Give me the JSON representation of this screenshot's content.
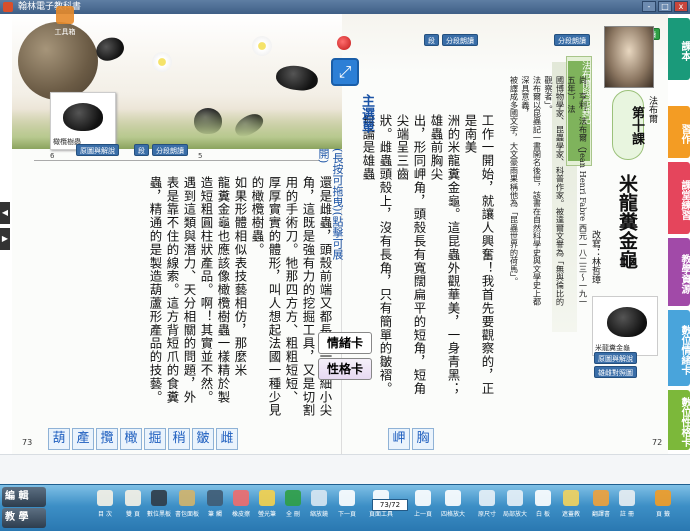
{
  "window": {
    "title": "翰林電子教科書",
    "buttons": [
      "-",
      "□",
      "x"
    ]
  },
  "left_page": {
    "specimen_label": "橄欖樹蟲",
    "tags": {
      "explain": "原圖與解說",
      "para": "段",
      "para_read": "分段朗讀"
    },
    "ruler_marks": [
      "6",
      "5"
    ],
    "columns": [
      "還是雌蟲，頭殼前端又都長出一對細小尖",
      "角，這既是強有力的挖掘工具，又是切割",
      "用的手術刀。牠那四方方、粗粗短短、",
      "厚厚實實的體形，叫人想起法國一種少見",
      "的橄欖樹蟲。",
      "如果形體相似表技藝相仿，那麼米",
      "龍糞金龜也應該像橄欖樹蟲一樣精於製",
      "造短粗圓柱狀產品。啊！其實並不然。",
      "遇到這類與潛力、天分相關的問題，外",
      "表是靠不住的線索。這方背短爪的食糞",
      "蟲，精通的是製造葫蘆形產品的技藝。"
    ],
    "page_number": "73",
    "vocab": [
      "葫",
      "產",
      "攬",
      "橄",
      "掘",
      "稍",
      "皺",
      "雌"
    ]
  },
  "main_menu": {
    "title": "主選單",
    "subtitle": "(長按可拖曳)(點擊可展開)"
  },
  "cards": {
    "emotion": "情緒卡",
    "personality": "性格卡"
  },
  "right_page": {
    "tags": {
      "para": "段",
      "para_read": "分段朗讀",
      "para_read2": "分段朗讀",
      "text_read": "課文朗讀",
      "explain": "原圖與解說",
      "compare": "雄雌對照圖"
    },
    "columns": [
      "工作一開始，就讓人興奮！我首先要觀察的，正是南美",
      "洲的米龍糞金龜。這昆蟲外觀華美，一身青黑；雄蟲前胸尖",
      "出，形同岬角，頭殼長有寬闊扁平的短角，短角尖端呈三齒",
      "狀。雌蟲頭殼上，沒有長角，只有簡單的皺褶。無論是雄蟲"
    ],
    "note_title": "法布爾與昆蟲記",
    "note_columns": [
      "尚．亨利．法布爾（Jean Henri Fabre 西元一八二三～一九一五年），法",
      "國博物學家、昆蟲學家、科普作家。被達爾文譽為「無與倫比的觀察者」。",
      "法布爾以昆蟲記一書開名後世，該書在自然科學史與文學史上都深具意義，",
      "被譯成多國文字，大文豪雨果稱他為「昆蟲世界的荷馬」。"
    ],
    "lesson": "第十課",
    "author_name": "法布爾",
    "title": "米龍糞金龜",
    "adaptation": "改寫：林哲璋",
    "specimen_label": "米龍糞金龜",
    "page_number": "72",
    "vocab": [
      "岬",
      "胸"
    ]
  },
  "side_tabs": [
    {
      "label": "課本",
      "color": "#1a9a7a"
    },
    {
      "label": "習作",
      "color": "#f39c24"
    },
    {
      "label": "課堂練習",
      "color": "#e5455c"
    },
    {
      "label": "教學資源",
      "color": "#a14aa8"
    },
    {
      "label": "數位情緒卡",
      "color": "#49a4db"
    },
    {
      "label": "數位性格卡",
      "color": "#7cb83a"
    }
  ],
  "left_tools": {
    "edit": "編 輯",
    "teach": "教 學",
    "toolbox": "工具箱"
  },
  "toolbar": [
    {
      "label": "目 次",
      "color": "#f6f2e6"
    },
    {
      "label": "雙 頁",
      "color": "#f6f2e6"
    },
    {
      "label": "數位黑板",
      "color": "#2f3b47"
    },
    {
      "label": "書包面板",
      "color": "#d3b46a"
    },
    {
      "label": "筆 觸",
      "color": "#3f5b73"
    },
    {
      "label": "橡皮擦",
      "color": "#ef6b6b"
    },
    {
      "label": "螢光筆",
      "color": "#f6d24b"
    },
    {
      "label": "全 刪",
      "color": "#2f9e45"
    },
    {
      "label": "縮放鏡",
      "color": "#d8e7f2"
    },
    {
      "label": "下一頁",
      "color": "#ffffff"
    },
    {
      "label": "頁面工具",
      "color": "#ffffff"
    },
    {
      "label": "上一頁",
      "color": "#ffffff"
    },
    {
      "label": "四格放大",
      "color": "#ffffff"
    },
    {
      "label": "原尺寸",
      "color": "#e8f1f7"
    },
    {
      "label": "局部放大",
      "color": "#e8f1f7"
    },
    {
      "label": "白 板",
      "color": "#ffffff"
    },
    {
      "label": "遮蓋教",
      "color": "#f3d35c"
    },
    {
      "label": "翻譯書",
      "color": "#f0a13a"
    },
    {
      "label": "註 冊",
      "color": "#e9eef2"
    },
    {
      "label": "頁 籤",
      "color": "#f39c24"
    }
  ],
  "page_box": "73/72"
}
